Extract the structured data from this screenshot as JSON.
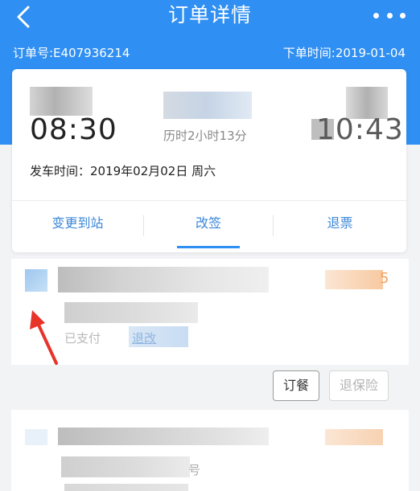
{
  "nav": {
    "title": "订单详情",
    "back_icon": "chevron-left-icon",
    "more_icon": "more-dots-icon"
  },
  "order": {
    "number_label": "订单号:E407936214",
    "time_label": "下单时间:2019-01-04"
  },
  "trip": {
    "depart_time": "08:30",
    "arrive_time": "10:43",
    "duration": "历时2小时13分",
    "depart_date": "发车时间：2019年02月02日 周六"
  },
  "actions": {
    "change_station": "变更到站",
    "reschedule": "改签",
    "refund": "退票"
  },
  "ticket1": {
    "paid_status": "已支付",
    "link_text": "退改"
  },
  "ticket1_buttons": {
    "meal": "订餐",
    "cancel_insurance": "退保险"
  },
  "ticket2": {
    "fragment": "号"
  },
  "colors": {
    "primary": "#2f8ff2",
    "link": "#3a87d9",
    "price_orange": "#f5a25d",
    "annotation_red": "#e8332a"
  }
}
